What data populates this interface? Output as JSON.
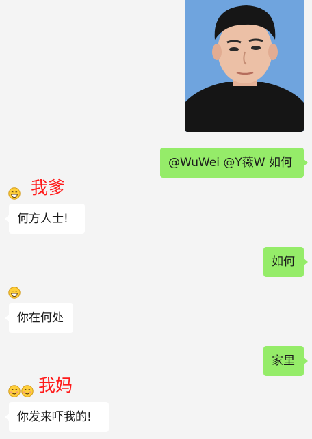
{
  "messages": {
    "m1": {
      "text": "@WuWei @Y薇W 如何"
    },
    "m2_sender": {
      "label": "我爹"
    },
    "m2": {
      "text": "何方人士!"
    },
    "m3": {
      "text": "如何"
    },
    "m4": {
      "text": "你在何处"
    },
    "m5": {
      "text": "家里"
    },
    "m6_sender": {
      "label": "我妈"
    },
    "m6": {
      "text": "你发来吓我的!"
    }
  },
  "colors": {
    "outgoing_bubble": "#95ec69",
    "incoming_bubble": "#ffffff",
    "background": "#f4f4f4",
    "sender_label": "#ff1a1a"
  },
  "icons": {
    "grin_emoji": "grinning-face-icon",
    "smile_emoji": "smiling-face-icon",
    "photo": "person-photo"
  }
}
